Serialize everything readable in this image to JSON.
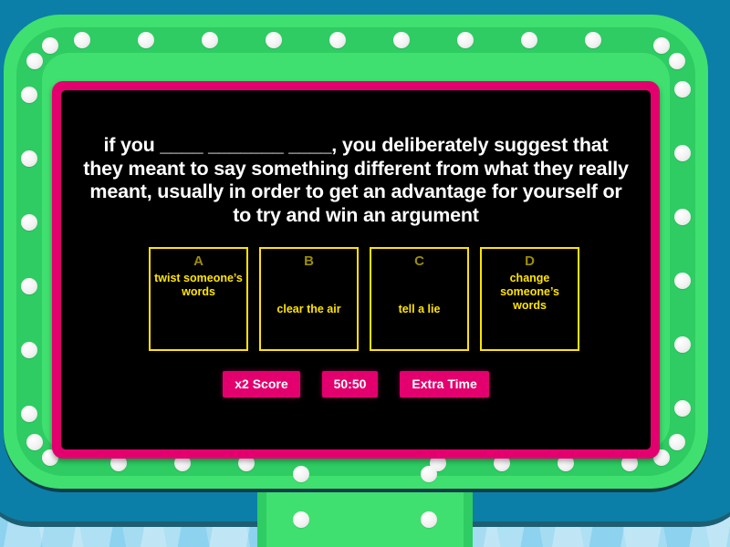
{
  "game": {
    "question": "if you ____ _______ ____, you deliberately suggest that they meant to say something different from what they really meant, usually in order to get an advantage for yourself or to try and win an argument",
    "answers": [
      {
        "letter": "A",
        "text": "twist someone’s words"
      },
      {
        "letter": "B",
        "text": "clear the air"
      },
      {
        "letter": "C",
        "text": "tell a lie"
      },
      {
        "letter": "D",
        "text": "change someone’s words"
      }
    ],
    "powerups": [
      {
        "label": "x2 Score"
      },
      {
        "label": "50:50"
      },
      {
        "label": "Extra Time"
      }
    ],
    "colors": {
      "frame_green": "#3fe06f",
      "frame_green_dark": "#2ecc62",
      "panel_pink": "#e3006e",
      "panel_black": "#000000",
      "card_border_yellow": "#ffe400",
      "card_text_yellow": "#ffe400",
      "card_letter_olive": "#9c8c0a",
      "shell_teal": "#0b7fa8",
      "background_blue": "#8dd2ef",
      "question_white": "#ffffff"
    }
  }
}
